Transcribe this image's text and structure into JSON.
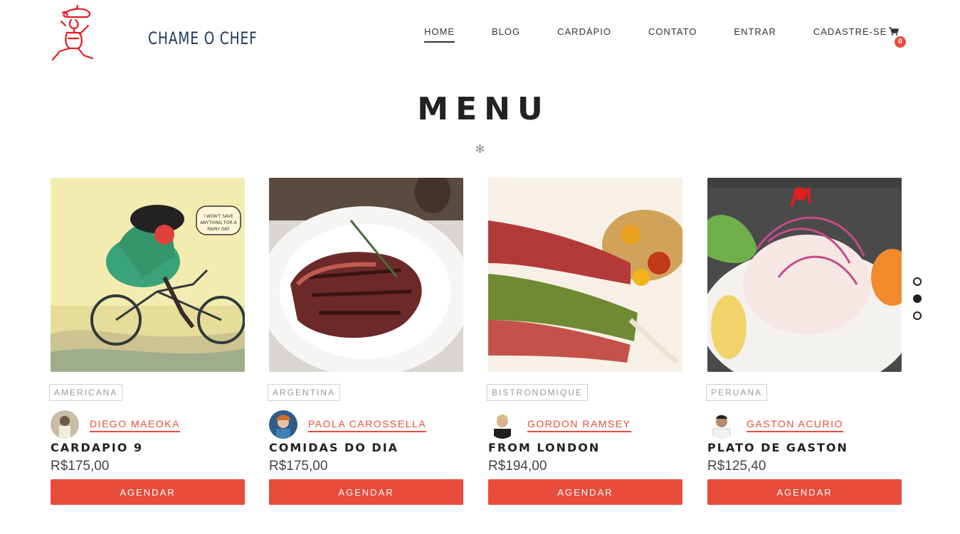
{
  "brand": {
    "name": "CHAME O CHEF",
    "logo_icon": "chef-waiter-logo-icon",
    "accent_color": "#e31b23",
    "text_color": "#1f3a60"
  },
  "nav": {
    "items": [
      {
        "label": "HOME",
        "active": true
      },
      {
        "label": "BLOG",
        "active": false
      },
      {
        "label": "CARDÁPIO",
        "active": false
      },
      {
        "label": "CONTATO",
        "active": false
      },
      {
        "label": "ENTRAR",
        "active": false
      },
      {
        "label": "CADASTRE-SE",
        "active": false
      }
    ],
    "cart": {
      "icon": "shopping-cart-icon",
      "count": "0"
    }
  },
  "page": {
    "title": "MENU",
    "ornament": "✻"
  },
  "accent_color": "#e74c3c",
  "menu_items": [
    {
      "tag": "AMERICANA",
      "chef": "DIEGO MAEOKA",
      "title": "CARDAPIO 9",
      "price": "R$175,00",
      "button": "AGENDAR",
      "image": "illustration-woman-on-bicycle"
    },
    {
      "tag": "ARGENTINA",
      "chef": "PAOLA CAROSSELLA",
      "title": "COMIDAS DO DIA",
      "price": "R$175,00",
      "button": "AGENDAR",
      "image": "sliced-steak-plate"
    },
    {
      "tag": "BISTRONOMIQUE",
      "chef": "GORDON RAMSEY",
      "title": "FROM LONDON",
      "price": "R$194,00",
      "button": "AGENDAR",
      "image": "herb-crusted-lamb-rack"
    },
    {
      "tag": "PERUANA",
      "chef": "GASTON ACURIO",
      "title": "PLATO DE GASTON",
      "price": "R$125,40",
      "button": "AGENDAR",
      "image": "ceviche-plate"
    }
  ],
  "slider": {
    "total": 3,
    "active_index": 1
  }
}
